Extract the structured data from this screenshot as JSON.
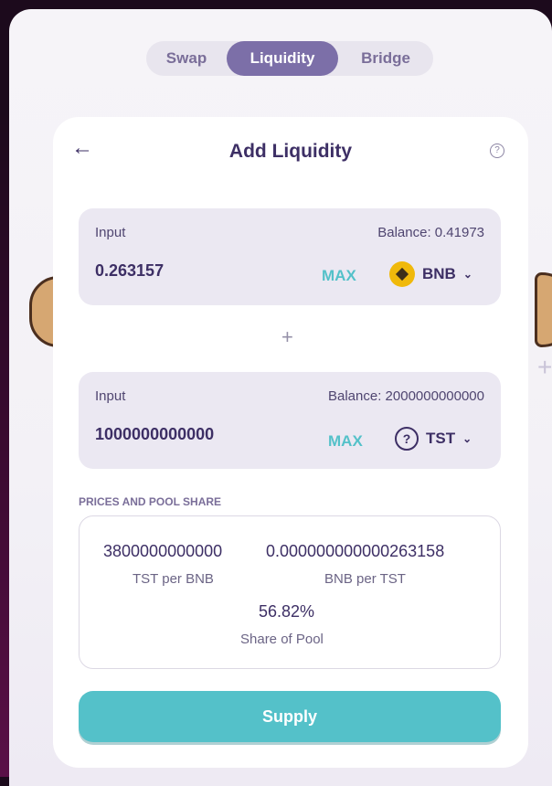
{
  "tabs": [
    {
      "label": "Swap"
    },
    {
      "label": "Liquidity"
    },
    {
      "label": "Bridge"
    }
  ],
  "active_tab": "Liquidity",
  "card": {
    "title": "Add Liquidity",
    "back_icon": "arrow-left-icon",
    "help_icon": "question-circle-icon",
    "help_glyph": "?"
  },
  "input_a": {
    "label": "Input",
    "balance": "Balance: 0.41973",
    "value": "0.263157",
    "max_label": "MAX",
    "token": "BNB",
    "token_icon": "bnb-icon"
  },
  "plus": "+",
  "input_b": {
    "label": "Input",
    "balance": "Balance: 2000000000000",
    "value": "1000000000000",
    "max_label": "MAX",
    "token": "TST",
    "token_icon": "question-circle-icon",
    "token_glyph": "?"
  },
  "prices": {
    "section_label": "PRICES AND POOL SHARE",
    "items": [
      {
        "value": "3800000000000",
        "caption": "TST per BNB"
      },
      {
        "value": "0.000000000000263158",
        "caption": "BNB per TST"
      },
      {
        "value": "56.82%",
        "caption": "Share of Pool"
      }
    ]
  },
  "supply_label": "Supply",
  "colors": {
    "accent_purple": "#7c6fa8",
    "accent_teal": "#54c1c9",
    "text_dark": "#3d2f65",
    "bnb_yellow": "#f0b90b"
  },
  "chevron_glyph": "⌄"
}
